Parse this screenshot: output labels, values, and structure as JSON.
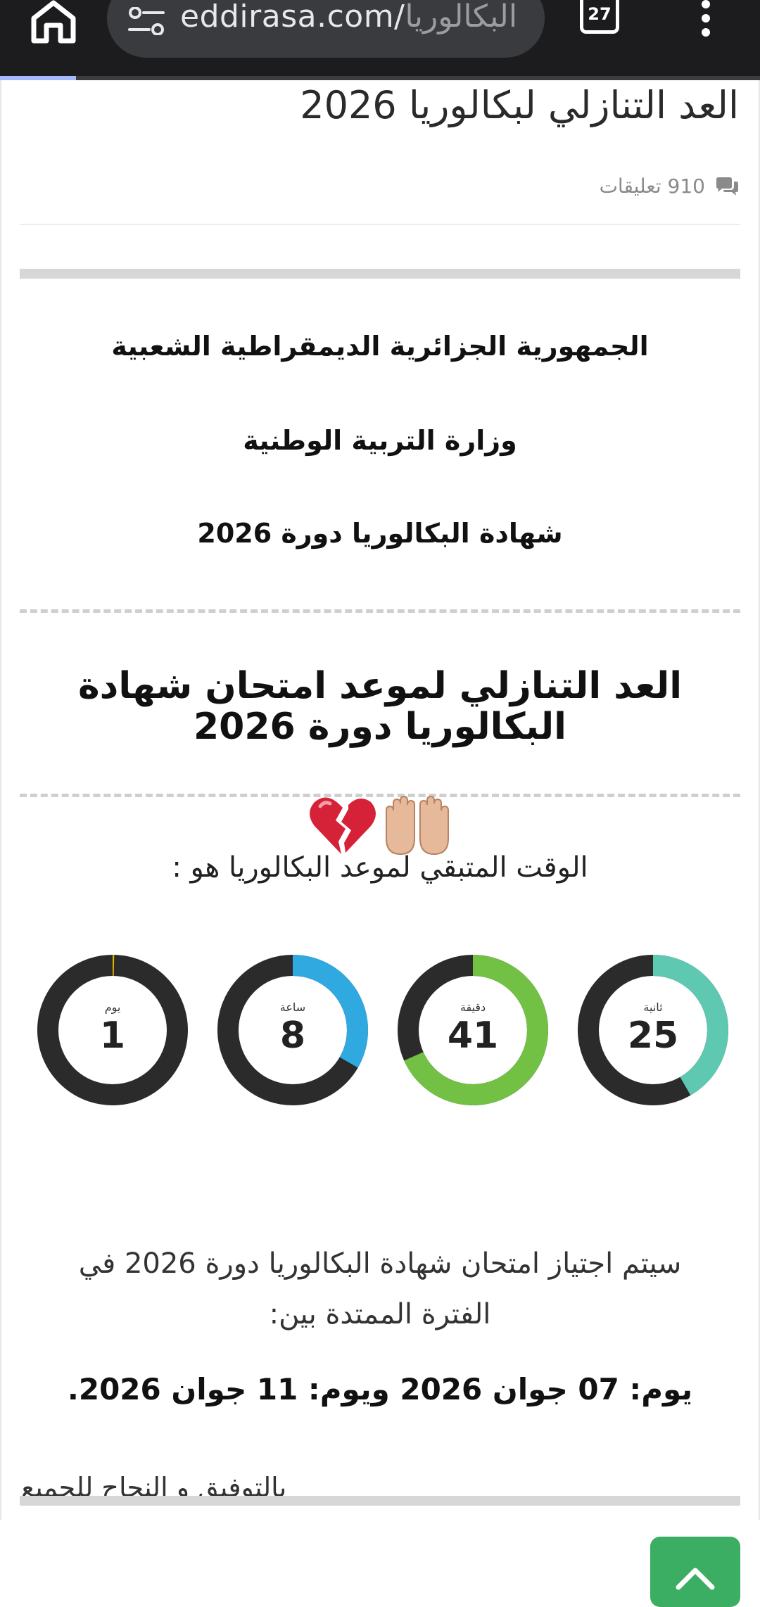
{
  "browser": {
    "url_domain": "eddirasa.com/",
    "url_path": "البكالوريا",
    "tab_count": "27",
    "page_load_progress": 0.1,
    "icons": [
      "home-icon",
      "site-settings-icon",
      "tabs-icon",
      "more-menu-icon"
    ]
  },
  "post": {
    "title": "العد التنازلي لبكالوريا 2026",
    "comments": "910 تعليقات"
  },
  "header": {
    "republic": "الجمهورية الجزائرية الديمقراطية الشعبية",
    "ministry": "وزارة التربية الوطنية",
    "certificate": "شهادة البكالوريا دورة 2026"
  },
  "countdown": {
    "title": "العد التنازلي لموعد امتحان شهادة البكالوريا دورة 2026",
    "remaining_label": "الوقت المتبقي لموعد البكالوريا هو :",
    "emojis": [
      "broken-heart",
      "raised-hands"
    ],
    "units": [
      {
        "key": "seconds",
        "label": "ثانية",
        "value": "25",
        "fraction": 0.4167,
        "color": "#5fc8b0"
      },
      {
        "key": "minutes",
        "label": "دقيقة",
        "value": "41",
        "fraction": 0.6833,
        "color": "#72c044"
      },
      {
        "key": "hours",
        "label": "ساعة",
        "value": "8",
        "fraction": 0.3333,
        "color": "#2fa9e0"
      },
      {
        "key": "days",
        "label": "يوم",
        "value": "1",
        "fraction": 0.003,
        "color": "#e0b400"
      }
    ],
    "track_color": "#2b2b2b"
  },
  "exam": {
    "period": "سيتم اجتياز امتحان شهادة البكالوريا دورة 2026 في الفترة الممتدة بين:",
    "dates": "يوم: 07 جوان 2026 ويوم: 11 جوان 2026.",
    "wish": "بالتوفيق و النجاح للجميع"
  },
  "accent_color": "#3cae63"
}
